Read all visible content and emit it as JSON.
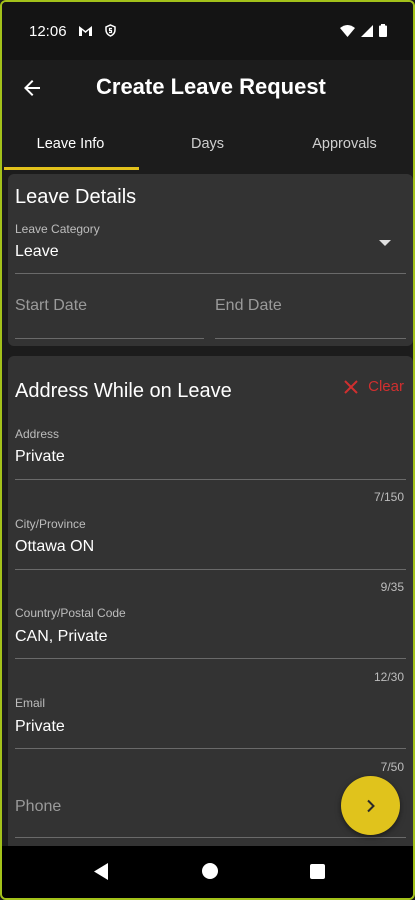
{
  "status_bar": {
    "time": "12:06",
    "left_icons": [
      "gmail-icon",
      "shield-s-icon"
    ],
    "right_icons": [
      "wifi-icon",
      "signal-icon",
      "battery-icon"
    ]
  },
  "app_bar": {
    "title": "Create Leave Request",
    "back_icon": "arrow-left-icon"
  },
  "tabs": [
    {
      "label": "Leave Info",
      "active": true
    },
    {
      "label": "Days",
      "active": false
    },
    {
      "label": "Approvals",
      "active": false
    }
  ],
  "leave_details": {
    "title": "Leave Details",
    "category": {
      "label": "Leave Category",
      "value": "Leave"
    },
    "start_date": {
      "placeholder": "Start Date"
    },
    "end_date": {
      "placeholder": "End Date"
    }
  },
  "address_section": {
    "title": "Address While on Leave",
    "clear_label": "Clear",
    "fields": [
      {
        "label": "Address",
        "value": "Private",
        "counter": "7/150"
      },
      {
        "label": "City/Province",
        "value": "Ottawa ON",
        "counter": "9/35"
      },
      {
        "label": "Country/Postal Code",
        "value": "CAN, Private",
        "counter": "12/30"
      },
      {
        "label": "Email",
        "value": "Private",
        "counter": "7/50"
      }
    ],
    "phone": {
      "placeholder": "Phone"
    }
  },
  "fab": {
    "icon": "chevron-right-icon"
  },
  "colors": {
    "accent": "#e2c11b",
    "card_bg": "#333333",
    "background": "#1c1c1c",
    "danger": "#d02f2f",
    "frame_border": "#a3c11a"
  }
}
